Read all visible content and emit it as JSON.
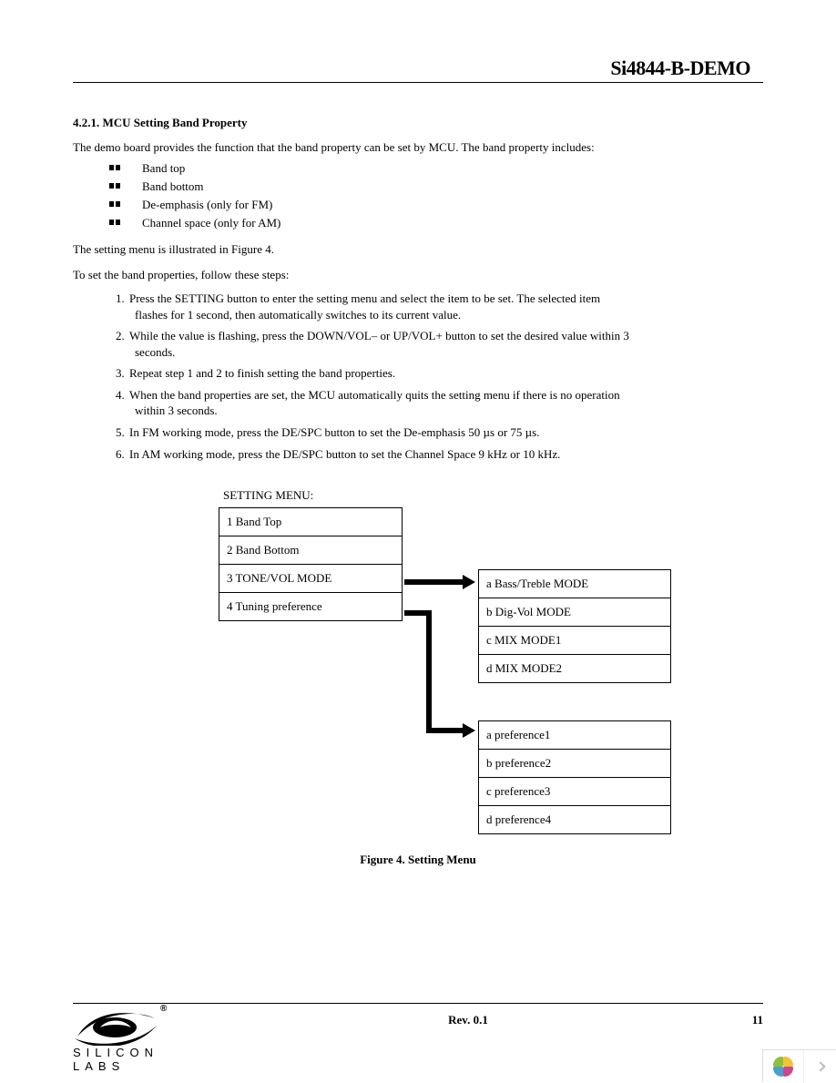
{
  "header": {
    "doc_title": "Si4844-B-DEMO"
  },
  "section": {
    "heading": "4.2.1. MCU Setting Band Property",
    "intro": "The demo board provides the function that the band property can be set by MCU. The band property includes:",
    "bullets": [
      "Band top",
      "Band bottom",
      "De-emphasis (only for FM)",
      "Channel space (only for AM)"
    ],
    "after_bullets": "The setting menu is illustrated in Figure 4.",
    "steps_intro": "To set the band properties, follow these steps:",
    "steps": [
      {
        "a": "Press the SETTING button to enter the setting menu and select the item to be set. The selected item",
        "b": "flashes for 1 second, then automatically switches to its current value."
      },
      {
        "a": "While the value is flashing, press the DOWN/VOL– or UP/VOL+ button to set the desired value within 3",
        "b": "seconds."
      },
      {
        "a": "Repeat step 1 and 2 to finish setting the band properties.",
        "b": ""
      },
      {
        "a": "When the band properties are set, the MCU automatically quits the setting menu if there is no operation",
        "b": "within 3 seconds."
      },
      {
        "a": "In FM working mode, press the DE/SPC button to set the De-emphasis 50 µs or 75 µs.",
        "b": ""
      },
      {
        "a": "In AM working mode, press the DE/SPC button to set the Channel Space 9 kHz or 10 kHz.",
        "b": ""
      }
    ]
  },
  "diagram": {
    "menu_title": "SETTING MENU:",
    "main": [
      "1 Band Top",
      "2 Band Bottom",
      "3 TONE/VOL MODE",
      "4 Tuning preference"
    ],
    "modes": [
      "a Bass/Treble MODE",
      "b Dig-Vol MODE",
      "c MIX MODE1",
      "d MIX MODE2"
    ],
    "prefs": [
      "a preference1",
      "b preference2",
      "c preference3",
      "d preference4"
    ],
    "caption": "Figure 4. Setting Menu"
  },
  "footer": {
    "brand": "SILICON LABS",
    "reg": "®",
    "rev": "Rev. 0.1",
    "page": "11"
  }
}
